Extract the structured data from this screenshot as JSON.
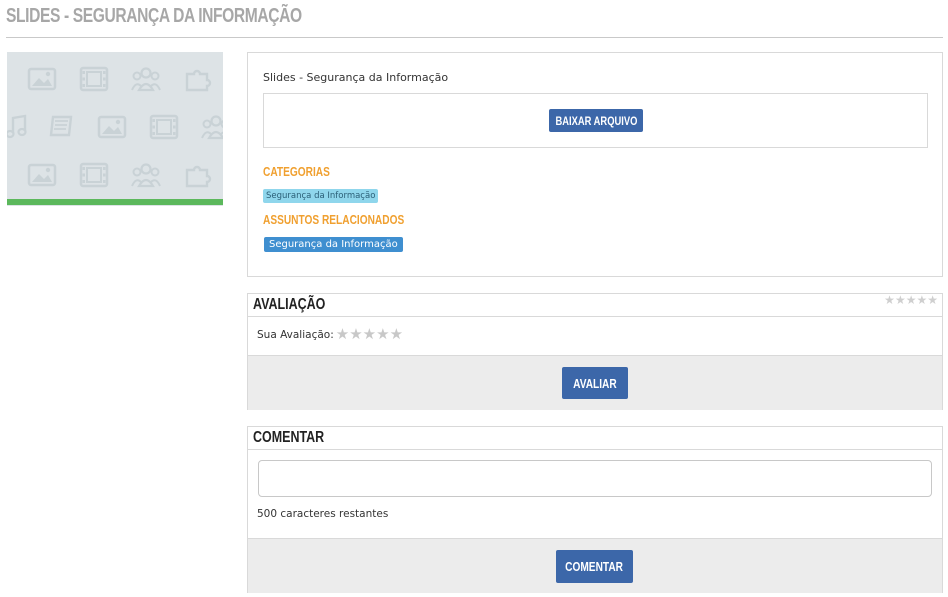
{
  "page": {
    "title": "SLIDES - SEGURANÇA DA INFORMAÇÃO"
  },
  "thumbnail": {
    "icons": [
      "image-icon",
      "film-icon",
      "users-icon",
      "puzzle-icon",
      "music-icon",
      "book-icon"
    ],
    "accent_color": "#5cb85c",
    "background_color": "#dde3e6"
  },
  "file": {
    "title": "Slides - Segurança da Informação",
    "download_label": "BAIXAR ARQUIVO",
    "categories_label": "CATEGORIAS",
    "category_tag": "Segurança da Informação",
    "related_label": "ASSUNTOS RELACIONADOS",
    "related_tag": "Segurança da Informação"
  },
  "rating": {
    "heading": "AVALIAÇÃO",
    "average_stars": 0,
    "average_max": 5,
    "your_rating_label": "Sua Avaliação:",
    "your_stars": 0,
    "submit_label": "AVALIAR"
  },
  "comment": {
    "heading": "COMENTAR",
    "value": "",
    "chars_left": "500 caracteres restantes",
    "submit_label": "COMENTAR"
  },
  "colors": {
    "primary_button": "#3c67a9",
    "section_label": "#f0a030",
    "category_tag_bg": "#8fd6ec",
    "related_tag_bg": "#3f8fd0",
    "page_title": "#a7a7a7"
  }
}
